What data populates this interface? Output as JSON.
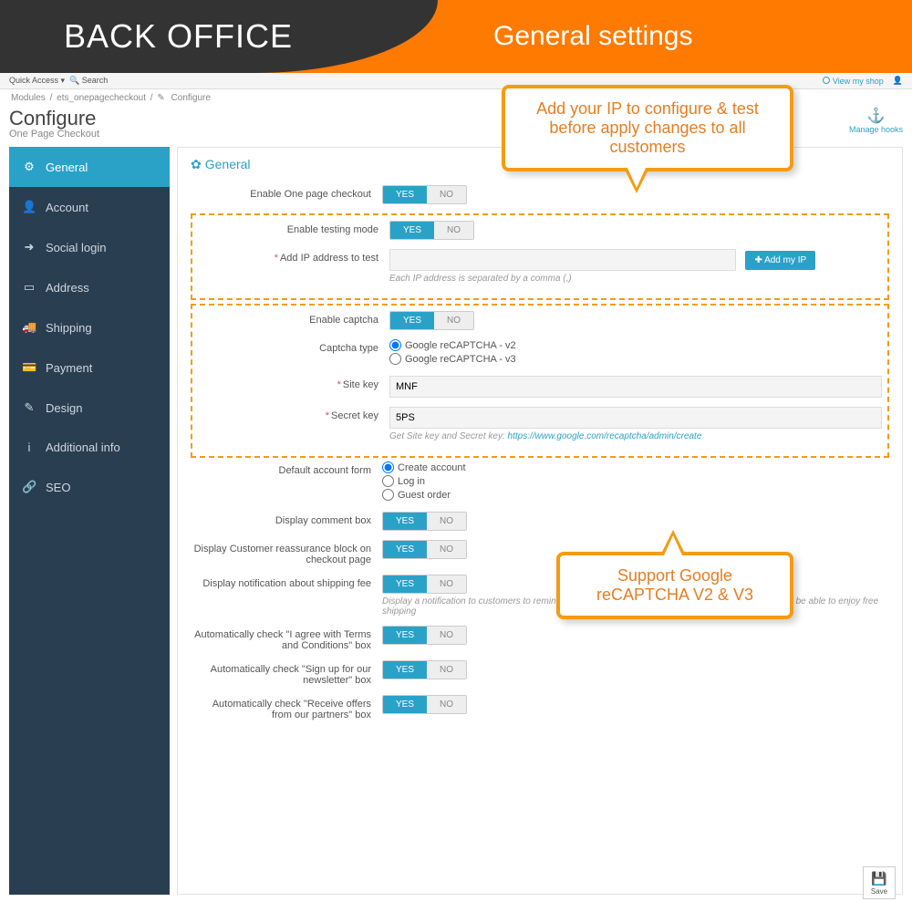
{
  "banner": {
    "back_office": "BACK OFFICE",
    "general_settings": "General settings"
  },
  "quickbar": {
    "quick_access": "Quick Access",
    "search": "Search",
    "view_shop": "View my shop"
  },
  "breadcrumbs": {
    "a": "Modules",
    "b": "ets_onepagecheckout",
    "c": "Configure"
  },
  "page": {
    "title": "Configure",
    "sub": "One Page Checkout"
  },
  "tools": {
    "manage_hooks": "Manage hooks"
  },
  "sidebar": {
    "items": [
      {
        "label": "General",
        "icon": "⚙"
      },
      {
        "label": "Account",
        "icon": "👤"
      },
      {
        "label": "Social login",
        "icon": "➜"
      },
      {
        "label": "Address",
        "icon": "▭"
      },
      {
        "label": "Shipping",
        "icon": "🚚"
      },
      {
        "label": "Payment",
        "icon": "💳"
      },
      {
        "label": "Design",
        "icon": "✎"
      },
      {
        "label": "Additional info",
        "icon": "i"
      },
      {
        "label": "SEO",
        "icon": "🔗"
      }
    ]
  },
  "panel": {
    "title": "General"
  },
  "toggle": {
    "yes": "YES",
    "no": "NO"
  },
  "form": {
    "enable_opc": "Enable One page checkout",
    "enable_testing": "Enable testing mode",
    "add_ip": "Add IP address to test",
    "add_ip_help": "Each IP address is separated by a comma (,)",
    "add_my_ip": "Add my IP",
    "enable_captcha": "Enable captcha",
    "captcha_type": "Captcha type",
    "captcha_v2": "Google reCAPTCHA - v2",
    "captcha_v3": "Google reCAPTCHA - v3",
    "site_key": "Site key",
    "site_key_val": "MNF",
    "secret_key": "Secret key",
    "secret_key_val": "5PS",
    "captcha_help_pre": "Get Site key and Secret key: ",
    "captcha_help_link": "https://www.google.com/recaptcha/admin/create",
    "default_form": "Default account form",
    "create_account": "Create account",
    "log_in": "Log in",
    "guest_order": "Guest order",
    "display_comment": "Display comment box",
    "display_reassurance": "Display Customer reassurance block on checkout page",
    "display_notification": "Display notification about shipping fee",
    "notification_help": "Display a notification to customers to remind them about how much money should they spend more to be able to enjoy free shipping",
    "auto_terms": "Automatically check \"I agree with Terms and Conditions\" box",
    "auto_newsletter": "Automatically check \"Sign up for our newsletter\" box",
    "auto_offers": "Automatically check \"Receive offers from our partners\" box"
  },
  "callouts": {
    "top": "Add your IP to configure & test before apply changes to all customers",
    "bot": "Support Google reCAPTCHA V2 & V3"
  },
  "save": "Save"
}
